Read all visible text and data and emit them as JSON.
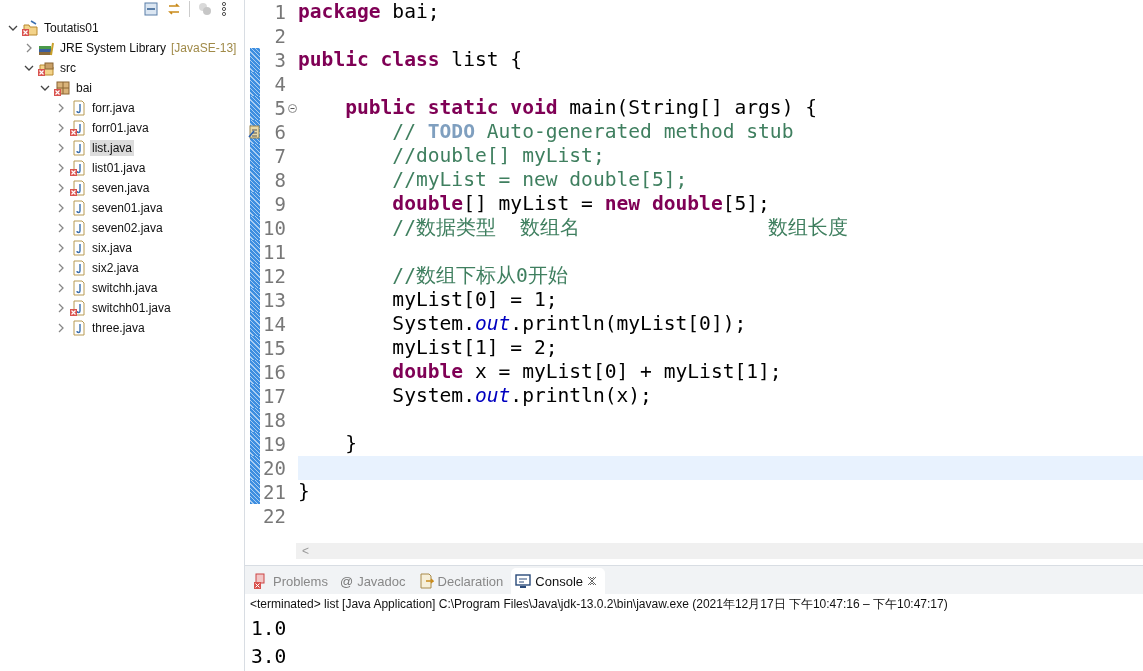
{
  "explorer": {
    "toolbar": [
      {
        "kind": "collapse",
        "disabled": false
      },
      {
        "kind": "link",
        "disabled": false
      },
      {
        "kind": "filter",
        "disabled": true
      },
      {
        "kind": "menu",
        "disabled": false
      }
    ],
    "tree": [
      {
        "label": "Toutatis01",
        "kind": "project",
        "error": true,
        "expanded": true,
        "selected": false,
        "children": [
          {
            "label": "JRE System Library",
            "note": "[JavaSE-13]",
            "kind": "library",
            "error": false,
            "expanded": false,
            "selected": false
          },
          {
            "label": "src",
            "kind": "source-folder",
            "error": true,
            "expanded": true,
            "selected": false,
            "children": [
              {
                "label": "bai",
                "kind": "package",
                "error": true,
                "expanded": true,
                "selected": false,
                "children": [
                  {
                    "label": "forr.java",
                    "kind": "java-file",
                    "error": false,
                    "expanded": false,
                    "selected": false
                  },
                  {
                    "label": "forr01.java",
                    "kind": "java-file",
                    "error": true,
                    "expanded": false,
                    "selected": false
                  },
                  {
                    "label": "list.java",
                    "kind": "java-file",
                    "error": false,
                    "expanded": false,
                    "selected": true
                  },
                  {
                    "label": "list01.java",
                    "kind": "java-file",
                    "error": true,
                    "expanded": false,
                    "selected": false
                  },
                  {
                    "label": "seven.java",
                    "kind": "java-file",
                    "error": true,
                    "expanded": false,
                    "selected": false
                  },
                  {
                    "label": "seven01.java",
                    "kind": "java-file",
                    "error": false,
                    "expanded": false,
                    "selected": false
                  },
                  {
                    "label": "seven02.java",
                    "kind": "java-file",
                    "error": false,
                    "expanded": false,
                    "selected": false
                  },
                  {
                    "label": "six.java",
                    "kind": "java-file",
                    "error": false,
                    "expanded": false,
                    "selected": false
                  },
                  {
                    "label": "six2.java",
                    "kind": "java-file",
                    "error": false,
                    "expanded": false,
                    "selected": false
                  },
                  {
                    "label": "switchh.java",
                    "kind": "java-file",
                    "error": false,
                    "expanded": false,
                    "selected": false
                  },
                  {
                    "label": "switchh01.java",
                    "kind": "java-file",
                    "error": true,
                    "expanded": false,
                    "selected": false
                  },
                  {
                    "label": "three.java",
                    "kind": "java-file",
                    "error": false,
                    "expanded": false,
                    "selected": false
                  }
                ]
              }
            ]
          }
        ]
      }
    ]
  },
  "editor": {
    "lines": [
      {
        "number": "1",
        "changed": false,
        "current": false,
        "fold_open": false,
        "task": false,
        "segments": [
          {
            "text": "package",
            "kind": "keyword"
          },
          {
            "text": " bai;",
            "kind": "plain"
          }
        ]
      },
      {
        "number": "2",
        "changed": false,
        "current": false,
        "fold_open": false,
        "task": false
      },
      {
        "number": "3",
        "changed": true,
        "current": false,
        "fold_open": false,
        "task": false,
        "segments": [
          {
            "text": "public class",
            "kind": "keyword"
          },
          {
            "text": " list {",
            "kind": "plain"
          }
        ]
      },
      {
        "number": "4",
        "changed": true,
        "current": false,
        "fold_open": false,
        "task": false
      },
      {
        "number": "5",
        "changed": true,
        "current": false,
        "fold_open": true,
        "task": false,
        "segments": [
          {
            "text": "    public static void",
            "kind": "keyword"
          },
          {
            "text": " main(String[] args) {",
            "kind": "plain"
          }
        ]
      },
      {
        "number": "6",
        "changed": true,
        "current": false,
        "fold_open": false,
        "task": true,
        "segments": [
          {
            "text": "        // ",
            "kind": "comment"
          },
          {
            "text": "TODO",
            "kind": "todo"
          },
          {
            "text": " Auto-generated method stub",
            "kind": "comment"
          }
        ]
      },
      {
        "number": "7",
        "changed": true,
        "current": false,
        "fold_open": false,
        "task": false,
        "segments": [
          {
            "text": "        //double[] myList;",
            "kind": "comment"
          }
        ]
      },
      {
        "number": "8",
        "changed": true,
        "current": false,
        "fold_open": false,
        "task": false,
        "segments": [
          {
            "text": "        //myList = new double[5];",
            "kind": "comment"
          }
        ]
      },
      {
        "number": "9",
        "changed": true,
        "current": false,
        "fold_open": false,
        "task": false,
        "segments": [
          {
            "text": "        double",
            "kind": "keyword"
          },
          {
            "text": "[] myList = ",
            "kind": "plain"
          },
          {
            "text": "new double",
            "kind": "keyword"
          },
          {
            "text": "[5];",
            "kind": "plain"
          }
        ]
      },
      {
        "number": "10",
        "changed": true,
        "current": false,
        "fold_open": false,
        "task": false,
        "segments": [
          {
            "text": "        //数据类型  数组名                数组长度",
            "kind": "comment"
          }
        ]
      },
      {
        "number": "11",
        "changed": true,
        "current": false,
        "fold_open": false,
        "task": false
      },
      {
        "number": "12",
        "changed": true,
        "current": false,
        "fold_open": false,
        "task": false,
        "segments": [
          {
            "text": "        //数组下标从0开始",
            "kind": "comment"
          }
        ]
      },
      {
        "number": "13",
        "changed": true,
        "current": false,
        "fold_open": false,
        "task": false,
        "segments": [
          {
            "text": "        myList[0] = 1;",
            "kind": "plain"
          }
        ]
      },
      {
        "number": "14",
        "changed": true,
        "current": false,
        "fold_open": false,
        "task": false,
        "segments": [
          {
            "text": "        System.",
            "kind": "plain"
          },
          {
            "text": "out",
            "kind": "static-field"
          },
          {
            "text": ".println(myList[0]);",
            "kind": "plain"
          }
        ]
      },
      {
        "number": "15",
        "changed": true,
        "current": false,
        "fold_open": false,
        "task": false,
        "segments": [
          {
            "text": "        myList[1] = 2;",
            "kind": "plain"
          }
        ]
      },
      {
        "number": "16",
        "changed": true,
        "current": false,
        "fold_open": false,
        "task": false,
        "segments": [
          {
            "text": "        double",
            "kind": "keyword"
          },
          {
            "text": " x = myList[0] + myList[1];",
            "kind": "plain"
          }
        ]
      },
      {
        "number": "17",
        "changed": true,
        "current": false,
        "fold_open": false,
        "task": false,
        "segments": [
          {
            "text": "        System.",
            "kind": "plain"
          },
          {
            "text": "out",
            "kind": "static-field"
          },
          {
            "text": ".println(x);",
            "kind": "plain"
          }
        ]
      },
      {
        "number": "18",
        "changed": true,
        "current": false,
        "fold_open": false,
        "task": false
      },
      {
        "number": "19",
        "changed": true,
        "current": false,
        "fold_open": false,
        "task": false,
        "segments": [
          {
            "text": "    }",
            "kind": "plain"
          }
        ]
      },
      {
        "number": "20",
        "changed": true,
        "current": true,
        "fold_open": false,
        "task": false
      },
      {
        "number": "21",
        "changed": true,
        "current": false,
        "fold_open": false,
        "task": false,
        "segments": [
          {
            "text": "}",
            "kind": "plain"
          }
        ]
      },
      {
        "number": "22",
        "changed": false,
        "current": false,
        "fold_open": false,
        "task": false
      }
    ],
    "scrollbar": {
      "arrow": "<"
    }
  },
  "bottom_panel": {
    "tabs": [
      {
        "label": "Problems",
        "kind": "problems",
        "selected": false,
        "closable": false
      },
      {
        "label": "Javadoc",
        "glyph": "@",
        "kind": "glyph",
        "selected": false,
        "closable": false
      },
      {
        "label": "Declaration",
        "kind": "declaration",
        "selected": false,
        "closable": false
      },
      {
        "label": "Console",
        "kind": "console",
        "selected": true,
        "closable": true
      }
    ],
    "console": {
      "header": "<terminated> list [Java Application] C:\\Program Files\\Java\\jdk-13.0.2\\bin\\javaw.exe  (2021年12月17日 下午10:47:16 – 下午10:47:17)",
      "output": [
        "1.0",
        "3.0"
      ]
    }
  }
}
